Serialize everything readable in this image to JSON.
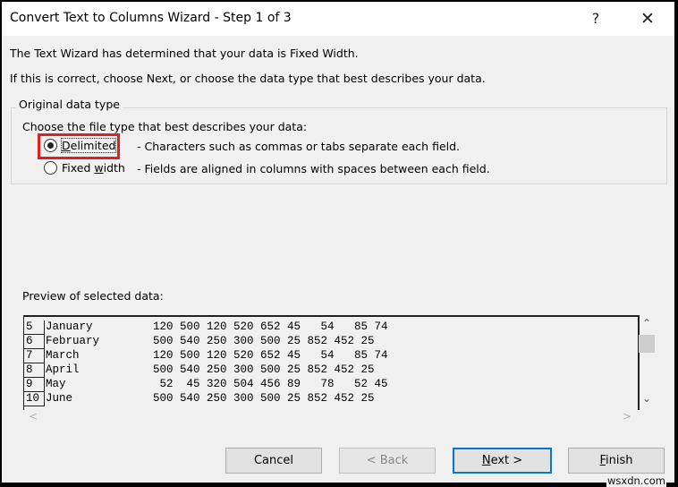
{
  "window": {
    "title": "Convert Text to Columns Wizard - Step 1 of 3",
    "help_label": "?",
    "close_label": "✕"
  },
  "intro": {
    "line1": "The Text Wizard has determined that your data is Fixed Width.",
    "line2": "If this is correct, choose Next, or choose the data type that best describes your data."
  },
  "original_data_type": {
    "legend": "Original data type",
    "prompt": "Choose the file type that best describes your data:",
    "options": [
      {
        "label_pre": "",
        "label_u": "D",
        "label_post": "elimited",
        "description": "- Characters such as commas or tabs separate each field.",
        "selected": true
      },
      {
        "label_pre": "Fixed ",
        "label_u": "w",
        "label_post": "idth",
        "description": "- Fields are aligned in columns with spaces between each field.",
        "selected": false
      }
    ]
  },
  "preview": {
    "label": "Preview of selected data:",
    "rows": [
      {
        "num": "5",
        "text": "January         120 500 120 520 652 45   54   85 74"
      },
      {
        "num": "6",
        "text": "February        500 540 250 300 500 25 852 452 25"
      },
      {
        "num": "7",
        "text": "March           120 500 120 520 652 45   54   85 74"
      },
      {
        "num": "8",
        "text": "April           500 540 250 300 500 25 852 452 25"
      },
      {
        "num": "9",
        "text": "May              52  45 320 504 456 89   78   52 45"
      },
      {
        "num": "10",
        "text": "June            500 540 250 300 500 25 852 452 25"
      }
    ],
    "scroll_up": "⌃",
    "scroll_down": "⌄",
    "scroll_left": "<",
    "scroll_right": ">"
  },
  "buttons": {
    "cancel": "Cancel",
    "back": "< Back",
    "next_u": "N",
    "next_rest": "ext >",
    "finish_u": "F",
    "finish_rest": "inish"
  },
  "watermark": "wsxdn.com",
  "colors": {
    "highlight": "#e02020",
    "default_button_border": "#0a73d6"
  }
}
